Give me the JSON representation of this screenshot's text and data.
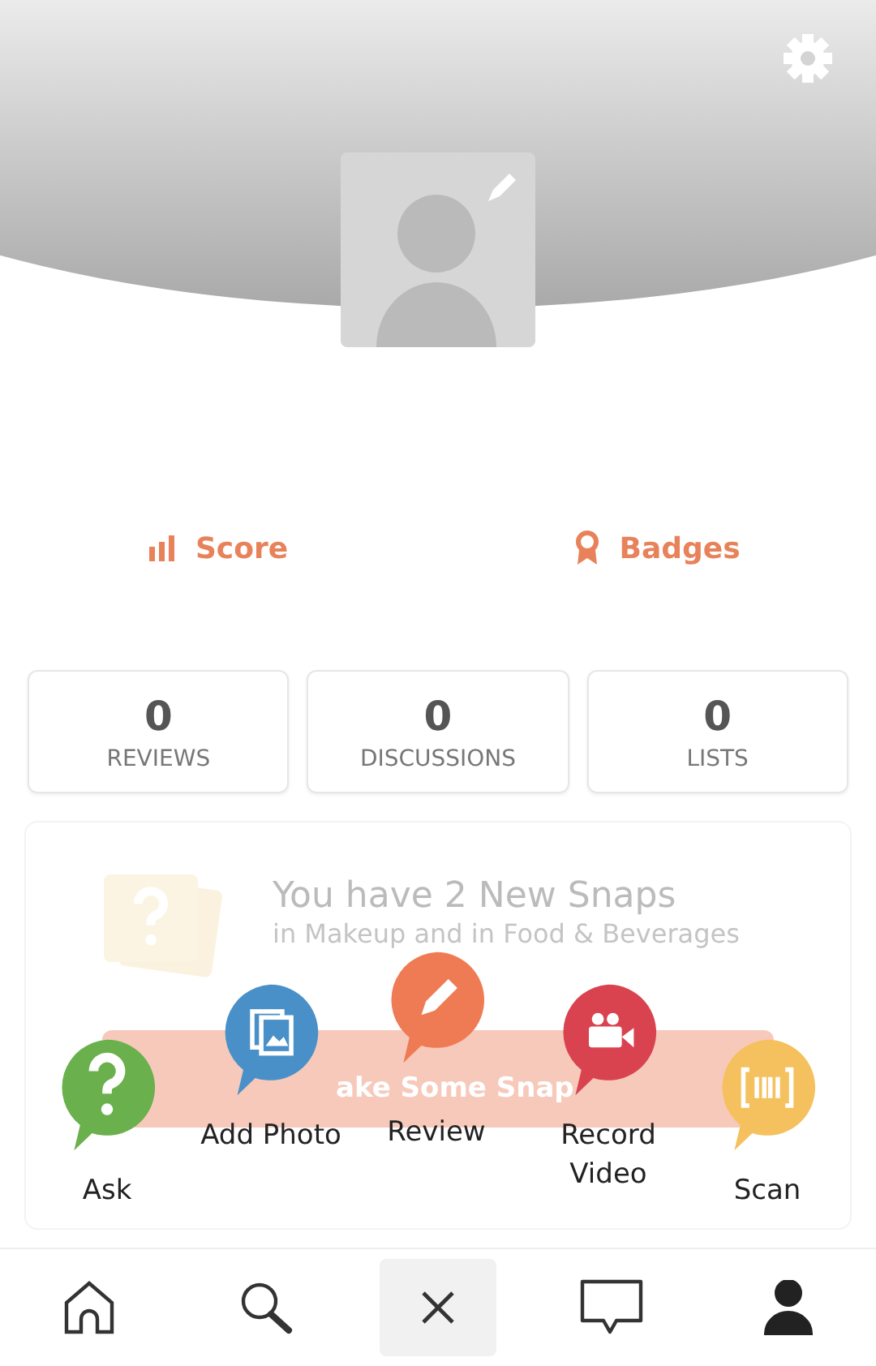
{
  "links": [
    {
      "kind": "score",
      "label": "Score"
    },
    {
      "kind": "badges",
      "label": "Badges"
    }
  ],
  "stats": [
    {
      "value": "0",
      "label": "REVIEWS"
    },
    {
      "value": "0",
      "label": "DISCUSSIONS"
    },
    {
      "value": "0",
      "label": "LISTS"
    }
  ],
  "snaps_card": {
    "title": "You have 2 New Snaps",
    "subtitle": "in Makeup and in Food & Beverages",
    "button": "ake Some Snap"
  },
  "actions": [
    {
      "kind": "ask",
      "label": "Ask",
      "color": "#6ab04c"
    },
    {
      "kind": "photo",
      "label": "Add Photo",
      "color": "#4a90c8"
    },
    {
      "kind": "review",
      "label": "Review",
      "color": "#ef7b55"
    },
    {
      "kind": "video",
      "label": "Record Video",
      "color": "#d9434f"
    },
    {
      "kind": "scan",
      "label": "Scan",
      "color": "#f5c15e"
    }
  ],
  "nav": [
    {
      "kind": "home",
      "selected": false
    },
    {
      "kind": "search",
      "selected": false
    },
    {
      "kind": "chat",
      "selected": false
    },
    {
      "kind": "profile",
      "selected": true
    }
  ],
  "center_button": {
    "kind": "close"
  }
}
